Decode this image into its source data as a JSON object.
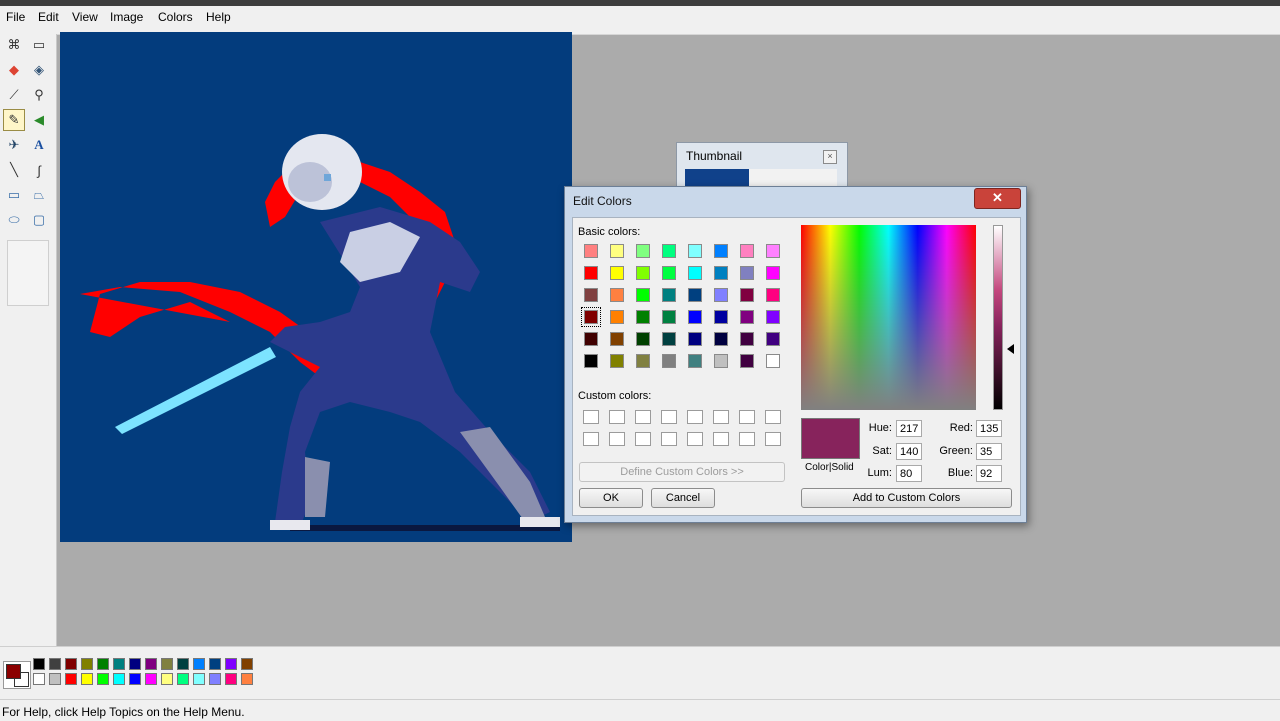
{
  "menu": [
    "File",
    "Edit",
    "View",
    "Image",
    "Colors",
    "Help"
  ],
  "tools": [
    "free-select-icon",
    "rect-select-icon",
    "eraser-icon",
    "fill-icon",
    "color-picker-icon",
    "magnifier-icon",
    "pencil-icon",
    "brush-icon",
    "airbrush-icon",
    "text-icon",
    "line-icon",
    "curve-icon",
    "rectangle-icon",
    "polygon-icon",
    "ellipse-icon",
    "rounded-rect-icon"
  ],
  "thumbnail": {
    "title": "Thumbnail",
    "close": "×"
  },
  "dialog": {
    "title": "Edit Colors",
    "close": "✕",
    "basic_label": "Basic colors:",
    "custom_label": "Custom colors:",
    "define_button": "Define Custom Colors >>",
    "ok_button": "OK",
    "cancel_button": "Cancel",
    "add_button": "Add to Custom Colors",
    "colorsolid_label": "Color|Solid",
    "hue_label": "Hue:",
    "hue": "217",
    "sat_label": "Sat:",
    "sat": "140",
    "lum_label": "Lum:",
    "lum": "80",
    "red_label": "Red:",
    "red": "135",
    "green_label": "Green:",
    "green": "35",
    "blue_label": "Blue:",
    "blue": "92",
    "current_color": "#87235c",
    "basic_colors": [
      [
        "#ff8080",
        "#ffff80",
        "#80ff80",
        "#00ff80",
        "#80ffff",
        "#0080ff",
        "#ff80c0",
        "#ff80ff"
      ],
      [
        "#ff0000",
        "#ffff00",
        "#80ff00",
        "#00ff40",
        "#00ffff",
        "#0080c0",
        "#8080c0",
        "#ff00ff"
      ],
      [
        "#804040",
        "#ff8040",
        "#00ff00",
        "#008080",
        "#004080",
        "#8080ff",
        "#800040",
        "#ff0080"
      ],
      [
        "#800000",
        "#ff8000",
        "#008000",
        "#008040",
        "#0000ff",
        "#0000a0",
        "#800080",
        "#8000ff"
      ],
      [
        "#400000",
        "#804000",
        "#004000",
        "#004040",
        "#000080",
        "#000040",
        "#400040",
        "#400080"
      ],
      [
        "#000000",
        "#808000",
        "#808040",
        "#808080",
        "#408080",
        "#c0c0c0",
        "#400040",
        "#ffffff"
      ]
    ]
  },
  "palette": [
    [
      "#000000",
      "#404040",
      "#800000",
      "#808000",
      "#008000",
      "#008080",
      "#000080",
      "#800080",
      "#808040",
      "#004040",
      "#0080ff",
      "#004080",
      "#8000ff",
      "#804000"
    ],
    [
      "#ffffff",
      "#c0c0c0",
      "#ff0000",
      "#ffff00",
      "#00ff00",
      "#00ffff",
      "#0000ff",
      "#ff00ff",
      "#ffff80",
      "#00ff80",
      "#80ffff",
      "#8080ff",
      "#ff0080",
      "#ff8040"
    ]
  ],
  "status": "For Help, click Help Topics on the Help Menu."
}
